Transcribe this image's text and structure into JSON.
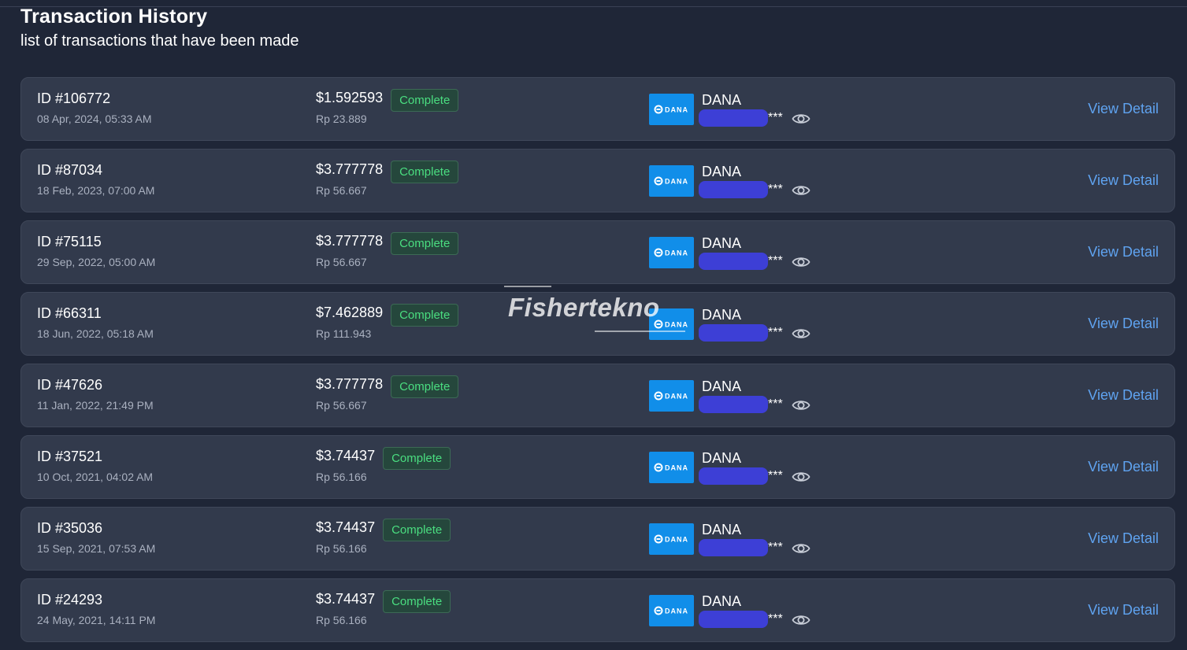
{
  "header": {
    "title": "Transaction History",
    "subtitle": "list of transactions that have been made"
  },
  "transactions": [
    {
      "id": "ID #106772",
      "date": "08 Apr, 2024, 05:33 AM",
      "amount": "$1.592593",
      "status": "Complete",
      "rp": "Rp 23.889",
      "wallet": "DANA",
      "mask": "***",
      "action": "View Detail"
    },
    {
      "id": "ID #87034",
      "date": "18 Feb, 2023, 07:00 AM",
      "amount": "$3.777778",
      "status": "Complete",
      "rp": "Rp 56.667",
      "wallet": "DANA",
      "mask": "***",
      "action": "View Detail"
    },
    {
      "id": "ID #75115",
      "date": "29 Sep, 2022, 05:00 AM",
      "amount": "$3.777778",
      "status": "Complete",
      "rp": "Rp 56.667",
      "wallet": "DANA",
      "mask": "***",
      "action": "View Detail"
    },
    {
      "id": "ID #66311",
      "date": "18 Jun, 2022, 05:18 AM",
      "amount": "$7.462889",
      "status": "Complete",
      "rp": "Rp 111.943",
      "wallet": "DANA",
      "mask": "***",
      "action": "View Detail"
    },
    {
      "id": "ID #47626",
      "date": "11 Jan, 2022, 21:49 PM",
      "amount": "$3.777778",
      "status": "Complete",
      "rp": "Rp 56.667",
      "wallet": "DANA",
      "mask": "***",
      "action": "View Detail"
    },
    {
      "id": "ID #37521",
      "date": "10 Oct, 2021, 04:02 AM",
      "amount": "$3.74437",
      "status": "Complete",
      "rp": "Rp 56.166",
      "wallet": "DANA",
      "mask": "***",
      "action": "View Detail"
    },
    {
      "id": "ID #35036",
      "date": "15 Sep, 2021, 07:53 AM",
      "amount": "$3.74437",
      "status": "Complete",
      "rp": "Rp 56.166",
      "wallet": "DANA",
      "mask": "***",
      "action": "View Detail"
    },
    {
      "id": "ID #24293",
      "date": "24 May, 2021, 14:11 PM",
      "amount": "$3.74437",
      "status": "Complete",
      "rp": "Rp 56.166",
      "wallet": "DANA",
      "mask": "***",
      "action": "View Detail"
    }
  ],
  "wallet_logo_text": "DANA",
  "watermark": "Fishertekno",
  "colors": {
    "background": "#1f2637",
    "card": "#323a4c",
    "status_green": "#4ade80",
    "link_blue": "#5fa3f0",
    "wallet_blue": "#118ee9",
    "redaction": "#3d3fd6"
  },
  "icons": {
    "eye": "eye-icon",
    "wallet": "dana-logo"
  }
}
